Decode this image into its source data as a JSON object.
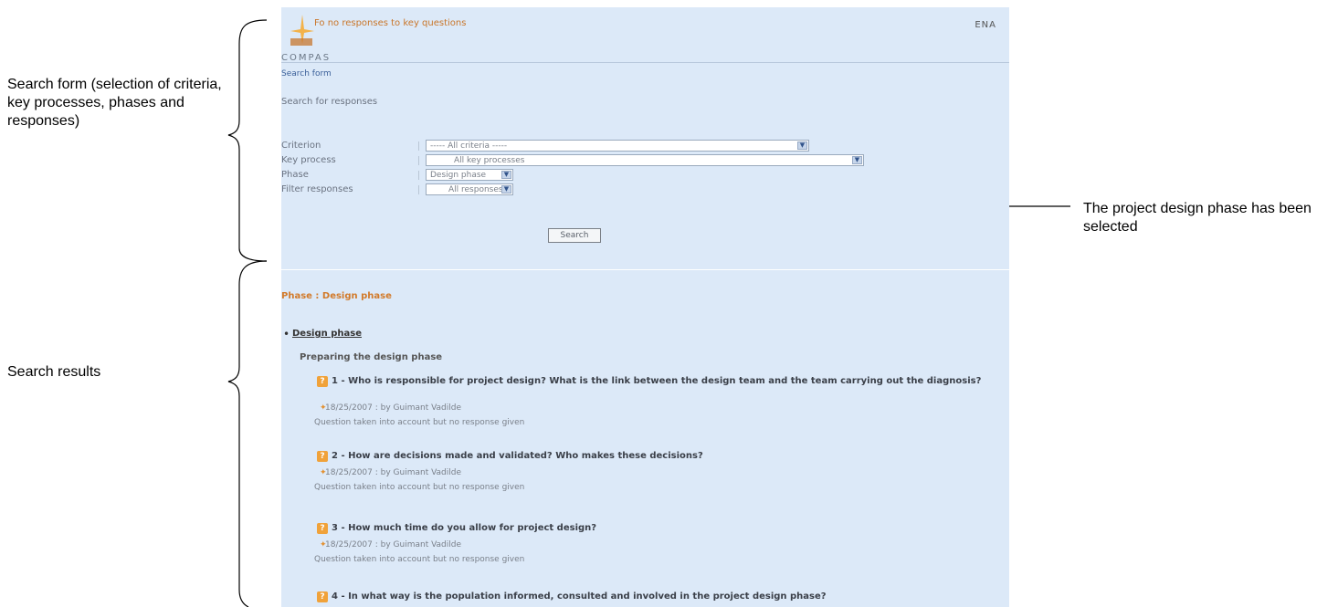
{
  "annotations": {
    "search_form": "Search form (selection of criteria, key processes, phases and responses)",
    "search_results": "Search results",
    "phase_selected": "The project design phase has been selected"
  },
  "header": {
    "app_title": "Fo no responses to key questions",
    "language": "ENA",
    "brand": "COMPAS"
  },
  "form": {
    "link": "Search form",
    "heading": "Search for responses",
    "criterion": {
      "label": "Criterion",
      "value": "----- All criteria -----"
    },
    "key_process": {
      "label": "Key process",
      "value": "All key processes"
    },
    "phase": {
      "label": "Phase",
      "value": "Design phase"
    },
    "filter": {
      "label": "Filter responses",
      "value": "All responses"
    },
    "search_button": "Search"
  },
  "results": {
    "phase_heading": "Phase : Design phase",
    "phase_link": "Design phase",
    "subheading": "Preparing the design phase",
    "questions": [
      {
        "text": "1 - Who is responsible for project design? What is the link between the design team and the team carrying out the diagnosis?",
        "meta": "18/25/2007 : by Guimant Vadilde",
        "status": "Question taken into account but no response given"
      },
      {
        "text": "2 - How are decisions made and validated? Who makes these decisions?",
        "meta": "18/25/2007 : by Guimant Vadilde",
        "status": "Question taken into account but no response given"
      },
      {
        "text": "3 - How much time do you allow for project design?",
        "meta": "18/25/2007 : by Guimant Vadilde",
        "status": "Question taken into account but no response given"
      },
      {
        "text": "4 - In what way is the population informed, consulted and involved in the project design phase?"
      }
    ]
  },
  "icons": {
    "question": "question-icon",
    "select_arrow": "chevron-down-icon",
    "meta": "star-icon"
  },
  "colors": {
    "panel_bg": "#dce9f8",
    "accent_orange": "#d27a2a",
    "link_blue": "#3a5f99"
  }
}
